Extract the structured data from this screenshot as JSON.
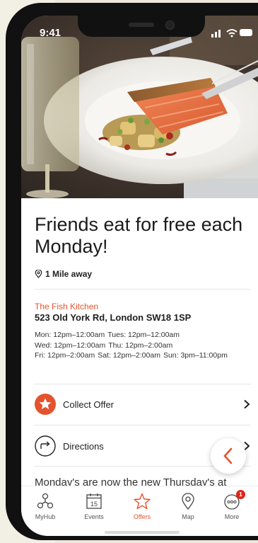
{
  "status_bar": {
    "time": "9:41"
  },
  "offer": {
    "title": "Friends eat for free each Monday!",
    "distance": "1 Mile away"
  },
  "venue": {
    "name": "The Fish Kitchen",
    "address": "523 Old York Rd, London SW18 1SP",
    "hours": [
      [
        "Mon: 12pm–12:00am",
        "Tues: 12pm–12:00am"
      ],
      [
        "Wed: 12pm–12:00am",
        "Thu: 12pm–2:00am"
      ],
      [
        "Fri: 12pm–2:00am",
        "Sat: 12pm–2:00am",
        "Sun: 3pm–11:00pm"
      ]
    ]
  },
  "actions": {
    "collect_offer": "Collect Offer",
    "directions": "Directions"
  },
  "description": "Monday's are now the new Thursday's at",
  "tabs": [
    {
      "label": "MyHub",
      "icon": "hub-icon"
    },
    {
      "label": "Events",
      "icon": "calendar-icon",
      "calendar_day": "15"
    },
    {
      "label": "Offers",
      "icon": "star-icon",
      "active": true
    },
    {
      "label": "Map",
      "icon": "map-pin-icon"
    },
    {
      "label": "More",
      "icon": "more-icon",
      "badge": "1"
    }
  ],
  "colors": {
    "accent": "#e5532d",
    "badge": "#e0231c"
  }
}
